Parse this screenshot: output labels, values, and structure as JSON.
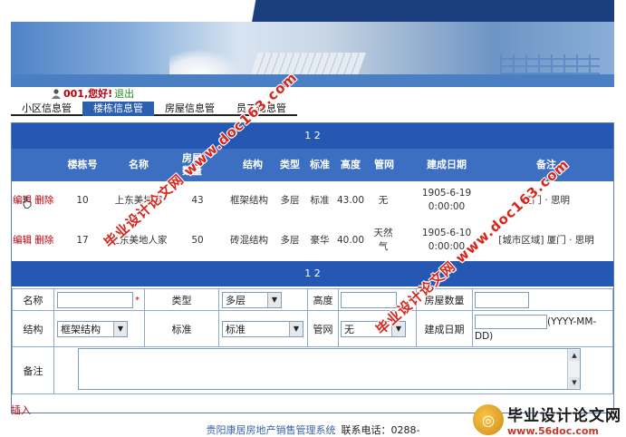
{
  "greeting": {
    "hello": "001,您好!",
    "logout": "退出"
  },
  "nav": {
    "tabs": [
      "小区信息管",
      "楼栋信息管",
      "房屋信息管",
      "员工信息管"
    ]
  },
  "list_header": {
    "pager": "1 2"
  },
  "columns": [
    "楼栋号",
    "名称",
    "房屋数量",
    "结构",
    "类型",
    "标准",
    "高度",
    "管网",
    "建成日期",
    "备注"
  ],
  "row_actions": {
    "edit": "编辑",
    "delete": "删除"
  },
  "rows": [
    {
      "number": "10",
      "name": "上东美地家",
      "count": "43",
      "structure": "框架结构",
      "type": "多层",
      "standard": "标准",
      "height": "43.00",
      "pipe": "无",
      "date": "1905-6-19 0:00:00",
      "remark": "厦门 · 思明"
    },
    {
      "number": "17",
      "name": "上东美地人家",
      "count": "50",
      "structure": "砖混结构",
      "type": "多层",
      "standard": "豪华",
      "height": "40.00",
      "pipe": "天然气",
      "date": "1905-6-10 0:00:00",
      "remark": "[城市区域] 厦门 · 思明"
    }
  ],
  "form_header": {
    "pager": "1 2"
  },
  "form": {
    "name_label": "名称",
    "name_value": "",
    "required_mark": "*",
    "type_label": "类型",
    "type_value": "多层",
    "height_label": "高度",
    "height_value": "",
    "count_label": "房屋数量",
    "count_value": "",
    "structure_label": "结构",
    "structure_value": "框架结构",
    "standard_label": "标准",
    "standard_value": "标准",
    "pipe_label": "管网",
    "pipe_value": "无",
    "date_label": "建成日期",
    "date_value": "",
    "date_hint": "(YYYY-MM-DD)",
    "remark_label": "备注",
    "remark_value": ""
  },
  "insert_link": "插入",
  "footer": {
    "name": "贵阳康居房地产销售管理系统",
    "tel": "联系电话：0288-"
  },
  "watermarks": [
    "毕业设计论文网 www.doc163.com",
    "毕业设计论文网 www.doc163.com"
  ],
  "corner_logo": {
    "title": "毕业设计论文网",
    "url": "www.56doc.com"
  },
  "colors": {
    "header_blue": "#2458b2",
    "column_blue": "#3c6fc2",
    "action_red": "#b3000c",
    "logout_green": "#2a8a2a"
  }
}
